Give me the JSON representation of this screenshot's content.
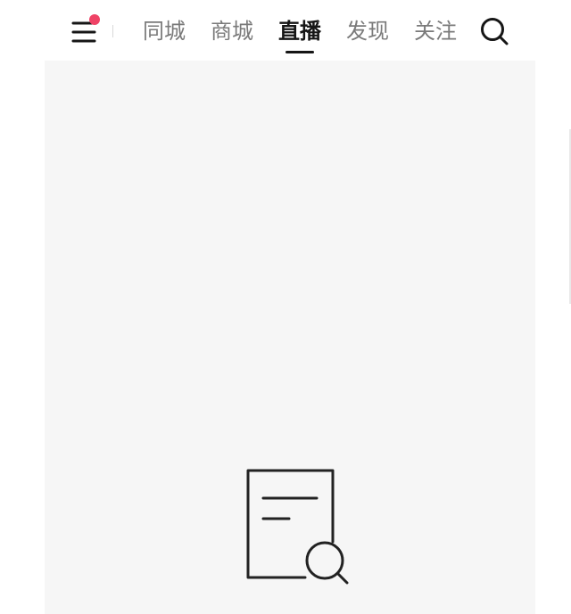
{
  "header": {
    "menu_icon": "menu-icon",
    "notification_dot_color": "#ef4366",
    "tabs": [
      {
        "label": "同城",
        "active": false
      },
      {
        "label": "商城",
        "active": false
      },
      {
        "label": "直播",
        "active": true
      },
      {
        "label": "发现",
        "active": false
      },
      {
        "label": "关注",
        "active": false
      }
    ],
    "search_icon": "search-icon"
  },
  "content": {
    "background_color": "#f6f6f6",
    "empty_state_icon": "document-search-icon"
  }
}
